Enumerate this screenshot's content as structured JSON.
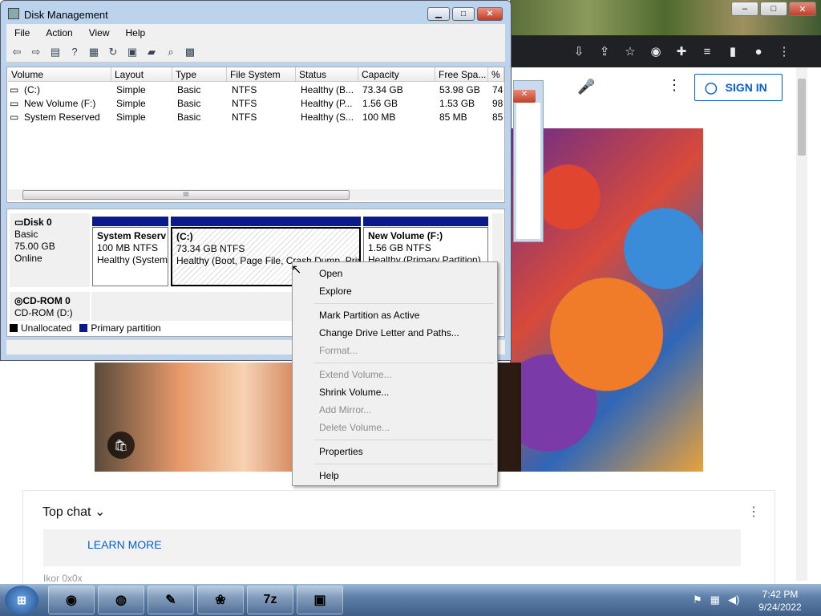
{
  "dm": {
    "title": "Disk Management",
    "menu": [
      "File",
      "Action",
      "View",
      "Help"
    ],
    "columns": [
      "Volume",
      "Layout",
      "Type",
      "File System",
      "Status",
      "Capacity",
      "Free Spa...",
      "% F"
    ],
    "rows": [
      [
        "(C:)",
        "Simple",
        "Basic",
        "NTFS",
        "Healthy (B...",
        "73.34 GB",
        "53.98 GB",
        "74"
      ],
      [
        "New Volume (F:)",
        "Simple",
        "Basic",
        "NTFS",
        "Healthy (P...",
        "1.56 GB",
        "1.53 GB",
        "98"
      ],
      [
        "System Reserved",
        "Simple",
        "Basic",
        "NTFS",
        "Healthy (S...",
        "100 MB",
        "85 MB",
        "85"
      ]
    ],
    "disk0": {
      "name": "Disk 0",
      "type": "Basic",
      "size": "75.00 GB",
      "state": "Online"
    },
    "cdrom": {
      "name": "CD-ROM 0",
      "sub": "CD-ROM (D:)"
    },
    "partitions": [
      {
        "name": "System Reserv",
        "size": "100 MB NTFS",
        "status": "Healthy (System"
      },
      {
        "name": "(C:)",
        "size": "73.34 GB NTFS",
        "status": "Healthy (Boot, Page File, Crash Dump, Prim"
      },
      {
        "name": "New Volume  (F:)",
        "size": "1.56 GB NTFS",
        "status": "Healthy (Primary Partition)"
      }
    ],
    "legend": {
      "unallocated": "Unallocated",
      "primary": "Primary partition"
    },
    "scroll_marker": "III"
  },
  "context_menu": {
    "items": [
      {
        "label": "Open",
        "enabled": true
      },
      {
        "label": "Explore",
        "enabled": true
      },
      {
        "label": "Mark Partition as Active",
        "enabled": true
      },
      {
        "label": "Change Drive Letter and Paths...",
        "enabled": true
      },
      {
        "label": "Format...",
        "enabled": false
      },
      {
        "label": "Extend Volume...",
        "enabled": false
      },
      {
        "label": "Shrink Volume...",
        "enabled": true
      },
      {
        "label": "Add Mirror...",
        "enabled": false
      },
      {
        "label": "Delete Volume...",
        "enabled": false
      },
      {
        "label": "Properties",
        "enabled": true
      },
      {
        "label": "Help",
        "enabled": true
      }
    ]
  },
  "browser": {
    "sign_in": "SIGN IN",
    "top_chat": "Top chat",
    "learn_more": "LEARN MORE",
    "chat_user": "Ikor 0x0x"
  },
  "taskbar": {
    "time": "7:42 PM",
    "date": "9/24/2022",
    "app_7z": "7z"
  },
  "colors": {
    "partition_header": "#0a1a8a",
    "link": "#065fd4"
  }
}
